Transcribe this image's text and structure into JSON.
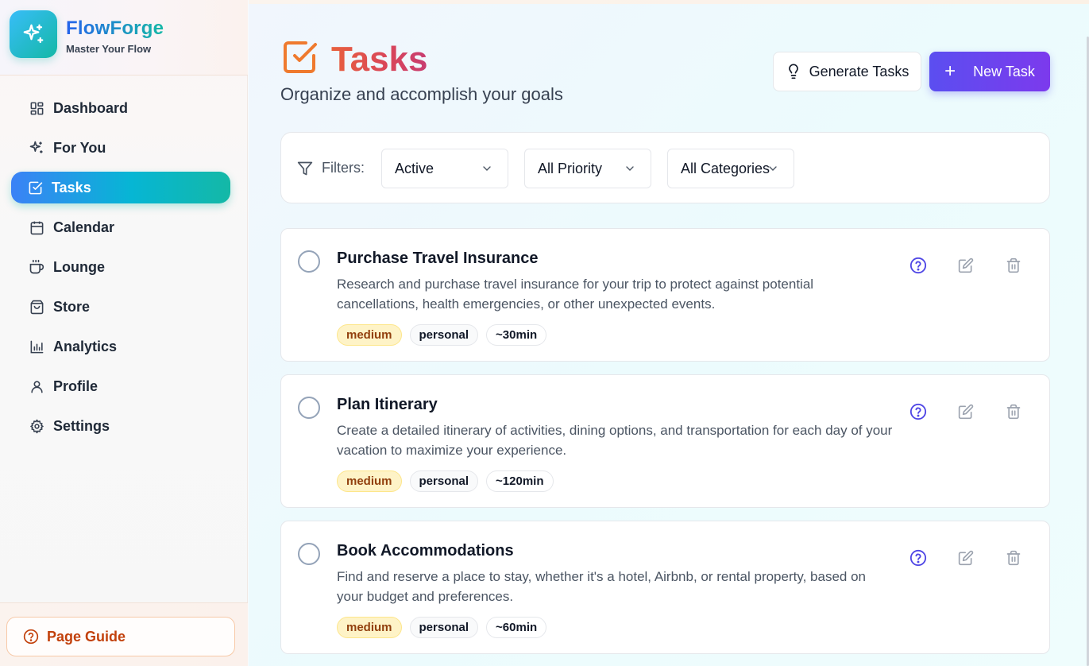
{
  "brand": {
    "name": "FlowForge",
    "tagline": "Master Your Flow"
  },
  "sidebar": {
    "items": [
      {
        "label": "Dashboard",
        "icon": "grid-icon"
      },
      {
        "label": "For You",
        "icon": "sparkle-icon"
      },
      {
        "label": "Tasks",
        "icon": "checkbox-icon",
        "active": true
      },
      {
        "label": "Calendar",
        "icon": "calendar-icon"
      },
      {
        "label": "Lounge",
        "icon": "coffee-icon"
      },
      {
        "label": "Store",
        "icon": "shopping-bag-icon"
      },
      {
        "label": "Analytics",
        "icon": "bar-chart-icon"
      },
      {
        "label": "Profile",
        "icon": "user-icon"
      },
      {
        "label": "Settings",
        "icon": "gear-icon"
      }
    ],
    "guide_label": "Page Guide"
  },
  "header": {
    "title": "Tasks",
    "subtitle": "Organize and accomplish your goals",
    "generate_label": "Generate Tasks",
    "new_label": "New Task"
  },
  "filters": {
    "label": "Filters:",
    "status": "Active",
    "priority": "All Priority",
    "category": "All Categories"
  },
  "tasks": [
    {
      "title": "Purchase Travel Insurance",
      "description": "Research and purchase travel insurance for your trip to protect against potential cancellations, health emergencies, or other unexpected events.",
      "priority": "medium",
      "category": "personal",
      "duration": "~30min"
    },
    {
      "title": "Plan Itinerary",
      "description": "Create a detailed itinerary of activities, dining options, and transportation for each day of your vacation to maximize your experience.",
      "priority": "medium",
      "category": "personal",
      "duration": "~120min"
    },
    {
      "title": "Book Accommodations",
      "description": "Find and reserve a place to stay, whether it's a hotel, Airbnb, or rental property, based on your budget and preferences.",
      "priority": "medium",
      "category": "personal",
      "duration": "~60min"
    }
  ],
  "colors": {
    "accent_purple": "#5b4ef0",
    "active_nav_teal": "#14b8a6",
    "title_orange": "#e8603d",
    "priority_medium_bg": "#fef3c7",
    "help_icon": "#4f46e5"
  }
}
